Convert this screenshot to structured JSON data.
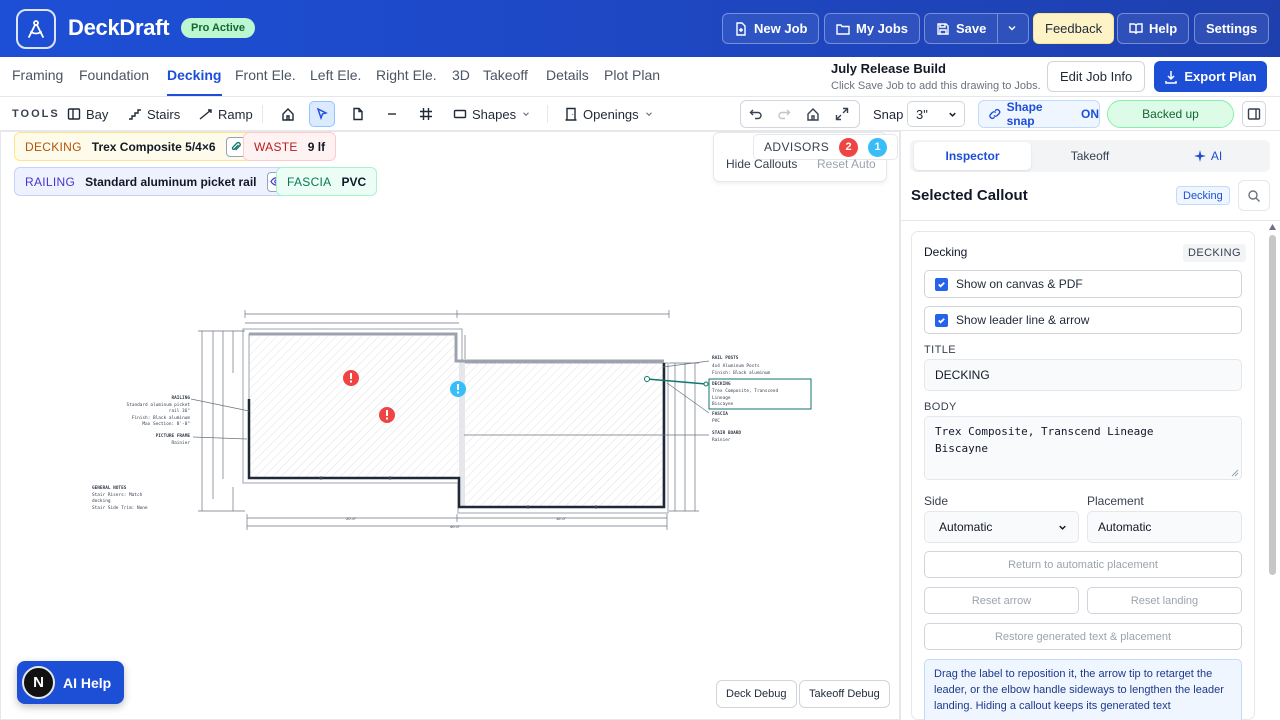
{
  "header": {
    "brand": "DeckDraft",
    "pro_badge": "Pro Active",
    "buttons": {
      "new_job": "New Job",
      "my_jobs": "My Jobs",
      "save": "Save",
      "feedback": "Feedback",
      "help": "Help",
      "settings": "Settings"
    }
  },
  "tabs": [
    "Framing",
    "Foundation",
    "Decking",
    "Front Ele.",
    "Left Ele.",
    "Right Ele.",
    "3D",
    "Takeoff",
    "Details",
    "Plot Plan"
  ],
  "active_tab": "Decking",
  "release": {
    "title": "July Release Build",
    "subtitle": "Click Save Job to add this drawing to Jobs."
  },
  "actions": {
    "edit_job": "Edit Job Info",
    "export": "Export Plan"
  },
  "toolbar": {
    "tools_label": "TOOLS",
    "bay": "Bay",
    "stairs": "Stairs",
    "ramp": "Ramp",
    "shapes": "Shapes",
    "openings": "Openings",
    "snap_label": "Snap",
    "snap_value": "3\"",
    "shape_snap": "Shape snap",
    "shape_snap_state": "ON",
    "backed_up": "Backed up"
  },
  "canvas": {
    "chips": {
      "decking": {
        "key": "DECKING",
        "value": "Trex Composite 5/4×6"
      },
      "waste": {
        "key": "WASTE",
        "value": "9 lf"
      },
      "railing": {
        "key": "RAILING",
        "value": "Standard aluminum picket rail"
      },
      "fascia": {
        "key": "FASCIA",
        "value": "PVC"
      }
    },
    "advisors": {
      "label": "ADVISORS",
      "red_count": "2",
      "blue_count": "1"
    },
    "hide_callouts": "Hide Callouts",
    "reset_auto": "Reset Auto",
    "deck_debug": "Deck Debug",
    "takeoff_debug": "Takeoff Debug",
    "ai_help": "AI Help",
    "ai_avatar": "N",
    "drawing": {
      "callouts": {
        "railing_title": "RAILING",
        "railing_lines": [
          "Standard aluminum picket",
          "rail 36\"",
          "Finish: Black aluminum",
          "Max Section: 8'-0\""
        ],
        "picture_frame_title": "PICTURE FRAME",
        "picture_frame_body": "Rainier",
        "general_notes_title": "GENERAL NOTES",
        "general_notes_lines": [
          "Stair Risers: Match",
          "decking",
          "Stair Side Trim: None"
        ],
        "rail_posts_title": "RAIL POSTS",
        "rail_posts_lines": [
          "4x4 Aluminum Posts",
          "Finish: Black aluminum"
        ],
        "decking_title": "DECKING",
        "decking_lines": [
          "Trex Composite, Transcend",
          "Lineage",
          "Biscayne"
        ],
        "fascia_title": "FASCIA",
        "fascia_body": "PVC",
        "stair_board_title": "STAIR BOARD",
        "stair_board_body": "Rainier"
      },
      "dimensions": {
        "bottom_left": "20'-0\"",
        "bottom_right": "16'-0\"",
        "bottom_total": "40'-0\""
      }
    }
  },
  "panel": {
    "tabs": {
      "inspector": "Inspector",
      "takeoff": "Takeoff",
      "ai": "AI"
    },
    "selected_title": "Selected Callout",
    "selected_badge": "Decking",
    "card_title": "Decking",
    "card_kind": "DECKING",
    "show_canvas": "Show on canvas & PDF",
    "show_leader": "Show leader line & arrow",
    "title_label": "TITLE",
    "title_value": "DECKING",
    "body_label": "BODY",
    "body_line1": "Trex Composite, Transcend Lineage",
    "body_line2": "Biscayne",
    "side_label": "Side",
    "side_value": "Automatic",
    "placement_label": "Placement",
    "placement_value": "Automatic",
    "return_auto": "Return to automatic placement",
    "reset_arrow": "Reset arrow",
    "reset_landing": "Reset landing",
    "restore": "Restore generated text & placement",
    "help_text": "Drag the label to reposition it, the arrow tip to retarget the leader, or the elbow handle sideways to lengthen the leader landing. Hiding a callout keeps its generated text"
  },
  "colors": {
    "header_blue": "#1d4fd6",
    "accent": "#1d4ed8",
    "advisor_red": "#ef4444",
    "advisor_blue": "#38bdf8",
    "teal_callout": "#0f766e"
  }
}
